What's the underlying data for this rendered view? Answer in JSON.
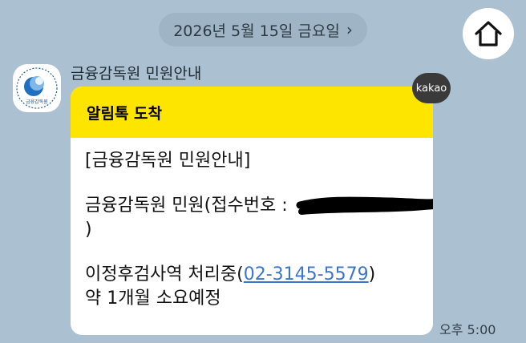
{
  "header": {
    "date_label": "2026년 5월 15일 금요일",
    "date_chevron": "›"
  },
  "home_icon": "home-icon",
  "sender": {
    "name": "금융감독원 민원안내",
    "avatar_text": "금융감독원"
  },
  "badge": {
    "label": "kakao"
  },
  "message": {
    "header_title": "알림톡 도착",
    "line1": "[금융감독원 민원안내]",
    "line2_prefix": "금융감독원 민원(접수번호 :",
    "line2_suffix": ")",
    "line3_prefix": "이정후검사역 처리중(",
    "phone": "02-3145-5579",
    "line3_suffix": ")",
    "line4": "약 1개월 소요예정"
  },
  "time": "오후 5:00",
  "colors": {
    "background": "#abc1d1",
    "header_yellow": "#fee500",
    "link_blue": "#3d76c8"
  }
}
